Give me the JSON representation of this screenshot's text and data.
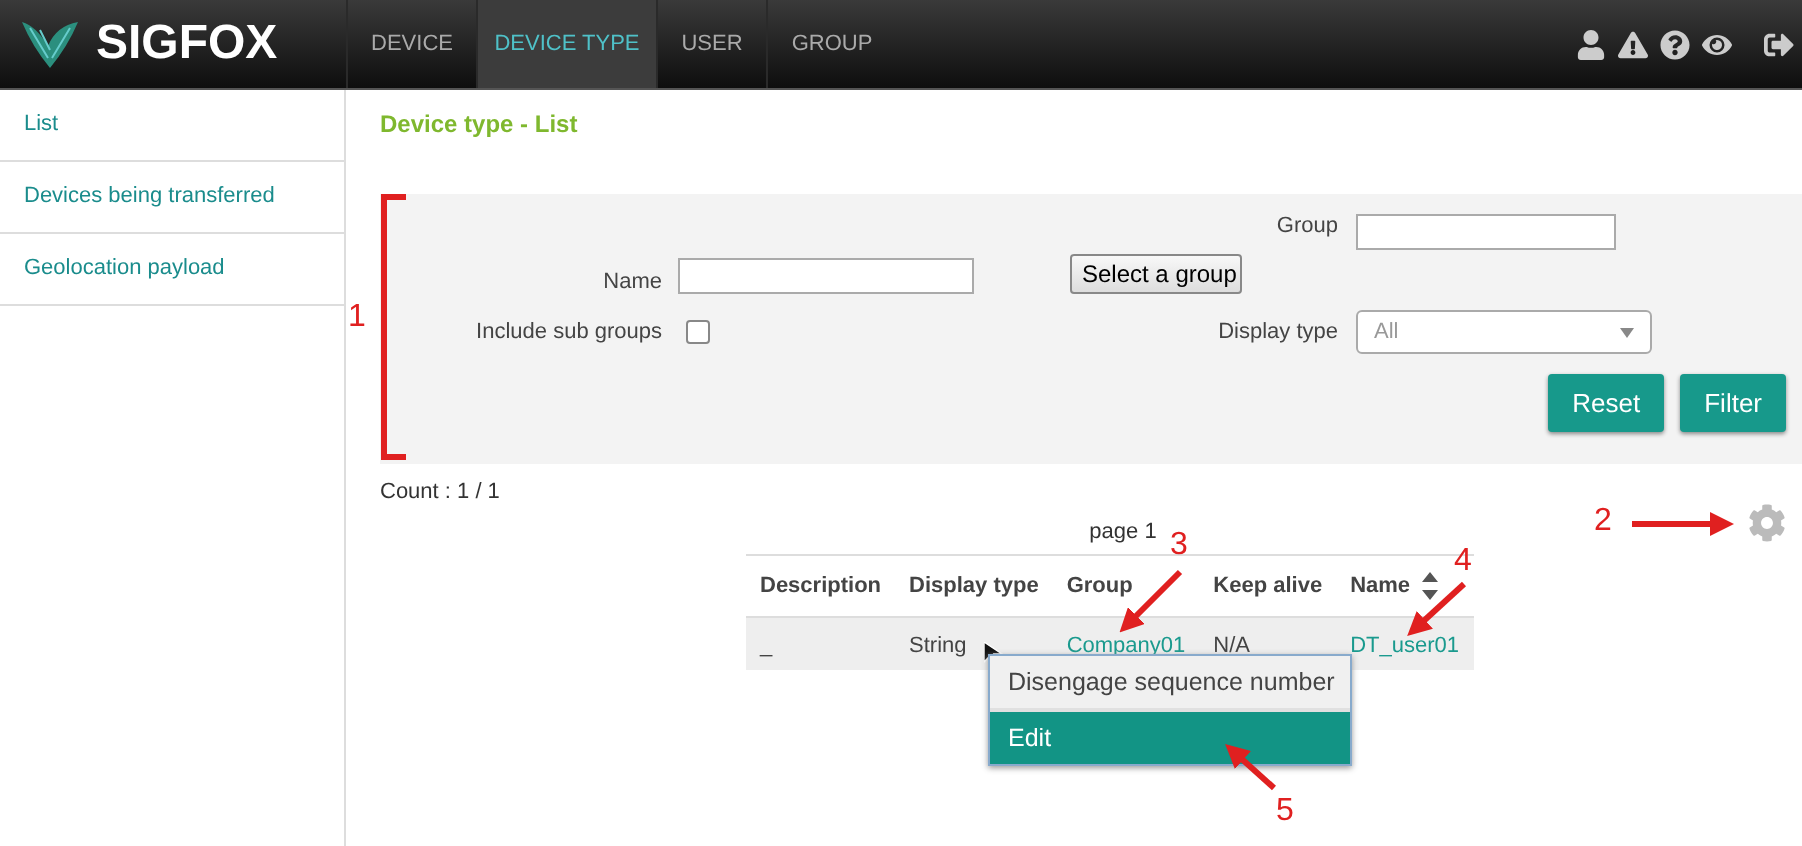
{
  "header": {
    "logo": "SIGFOX",
    "nav": [
      {
        "label": "DEVICE",
        "selected": false
      },
      {
        "label": "DEVICE TYPE",
        "selected": true
      },
      {
        "label": "USER",
        "selected": false
      },
      {
        "label": "GROUP",
        "selected": false
      }
    ]
  },
  "sidebar": {
    "items": [
      {
        "label": "List"
      },
      {
        "label": "Devices being transferred"
      },
      {
        "label": "Geolocation payload"
      }
    ]
  },
  "page_title": "Device type - List",
  "filter": {
    "name_label": "Name",
    "select_group_button": "Select a group",
    "group_label": "Group",
    "include_sub_groups_label": "Include sub groups",
    "include_sub_groups_checked": false,
    "display_type_label": "Display type",
    "display_type_value": "All",
    "buttons": [
      "Reset",
      "Filter"
    ]
  },
  "count": "Count : 1 / 1",
  "pagination": "page 1",
  "table": {
    "columns": [
      {
        "label": "Description",
        "sortable": false
      },
      {
        "label": "Display type",
        "sortable": false
      },
      {
        "label": "Group",
        "sortable": false
      },
      {
        "label": "Keep alive",
        "sortable": false
      },
      {
        "label": "Name",
        "sortable": true
      }
    ],
    "rows": [
      {
        "cells": [
          {
            "text": "_",
            "kind": "text"
          },
          {
            "text": "String",
            "kind": "text"
          },
          {
            "text": "Company01",
            "kind": "link"
          },
          {
            "text": "N/A",
            "kind": "text"
          },
          {
            "text": "DT_user01",
            "kind": "link"
          }
        ]
      }
    ]
  },
  "context_menu": {
    "items": [
      {
        "label": "Disengage sequence number",
        "selected": false
      },
      {
        "label": "Edit",
        "selected": true
      }
    ]
  },
  "annotations": [
    "1",
    "2",
    "3",
    "4",
    "5"
  ]
}
